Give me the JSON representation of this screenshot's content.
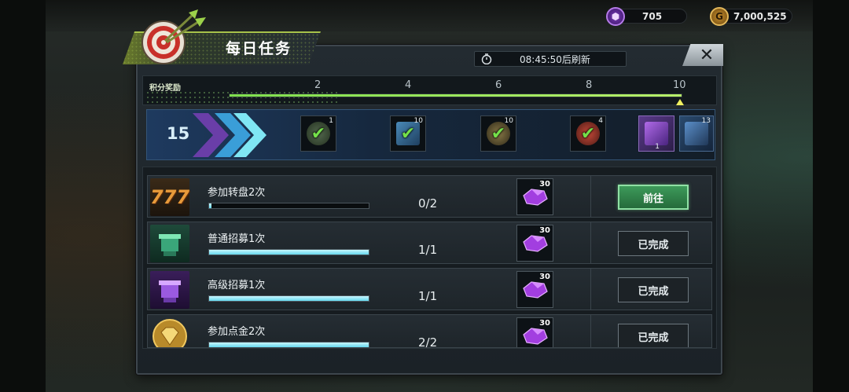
{
  "currencies": {
    "gems": "705",
    "gold": "7,000,525",
    "gem_icon_glyph": "⬢",
    "gold_icon_glyph": "G"
  },
  "title": "每日任务",
  "timer": "08:45:50后刷新",
  "close_glyph": "✕",
  "score": {
    "label": "积分奖励",
    "current_points": "15",
    "ticks": [
      "2",
      "4",
      "6",
      "8",
      "10"
    ],
    "progress_fraction": 1.0
  },
  "milestone_rewards": [
    {
      "icon": "grenade-icon",
      "count": "1",
      "claimed": true
    },
    {
      "icon": "ticket-icon",
      "count": "10",
      "claimed": true
    },
    {
      "icon": "crossed-tools-icon",
      "count": "10",
      "claimed": true
    },
    {
      "icon": "medkit-icon",
      "count": "4",
      "claimed": true
    },
    {
      "icon": "purple-crate-icon",
      "count": "1",
      "claimed": false
    },
    {
      "icon": "blue-crate-icon",
      "count": "13",
      "claimed": false
    }
  ],
  "tasks": [
    {
      "name": "参加转盘2次",
      "progress": "0/2",
      "fraction": 0.0,
      "reward_count": "30",
      "button": "前往",
      "state": "go",
      "icon": "slot-777-icon"
    },
    {
      "name": "普通招募1次",
      "progress": "1/1",
      "fraction": 1.0,
      "reward_count": "30",
      "button": "已完成",
      "state": "done",
      "icon": "green-recruit-icon"
    },
    {
      "name": "高级招募1次",
      "progress": "1/1",
      "fraction": 1.0,
      "reward_count": "30",
      "button": "已完成",
      "state": "done",
      "icon": "purple-recruit-icon"
    },
    {
      "name": "参加点金2次",
      "progress": "2/2",
      "fraction": 1.0,
      "reward_count": "30",
      "button": "已完成",
      "state": "done",
      "icon": "gold-diamond-icon"
    }
  ],
  "colors": {
    "accent_green": "#74e04a",
    "progress_cyan": "#66d9ee",
    "panel_bg": "#1b2227",
    "gem_purple": "#9b3fd8"
  }
}
